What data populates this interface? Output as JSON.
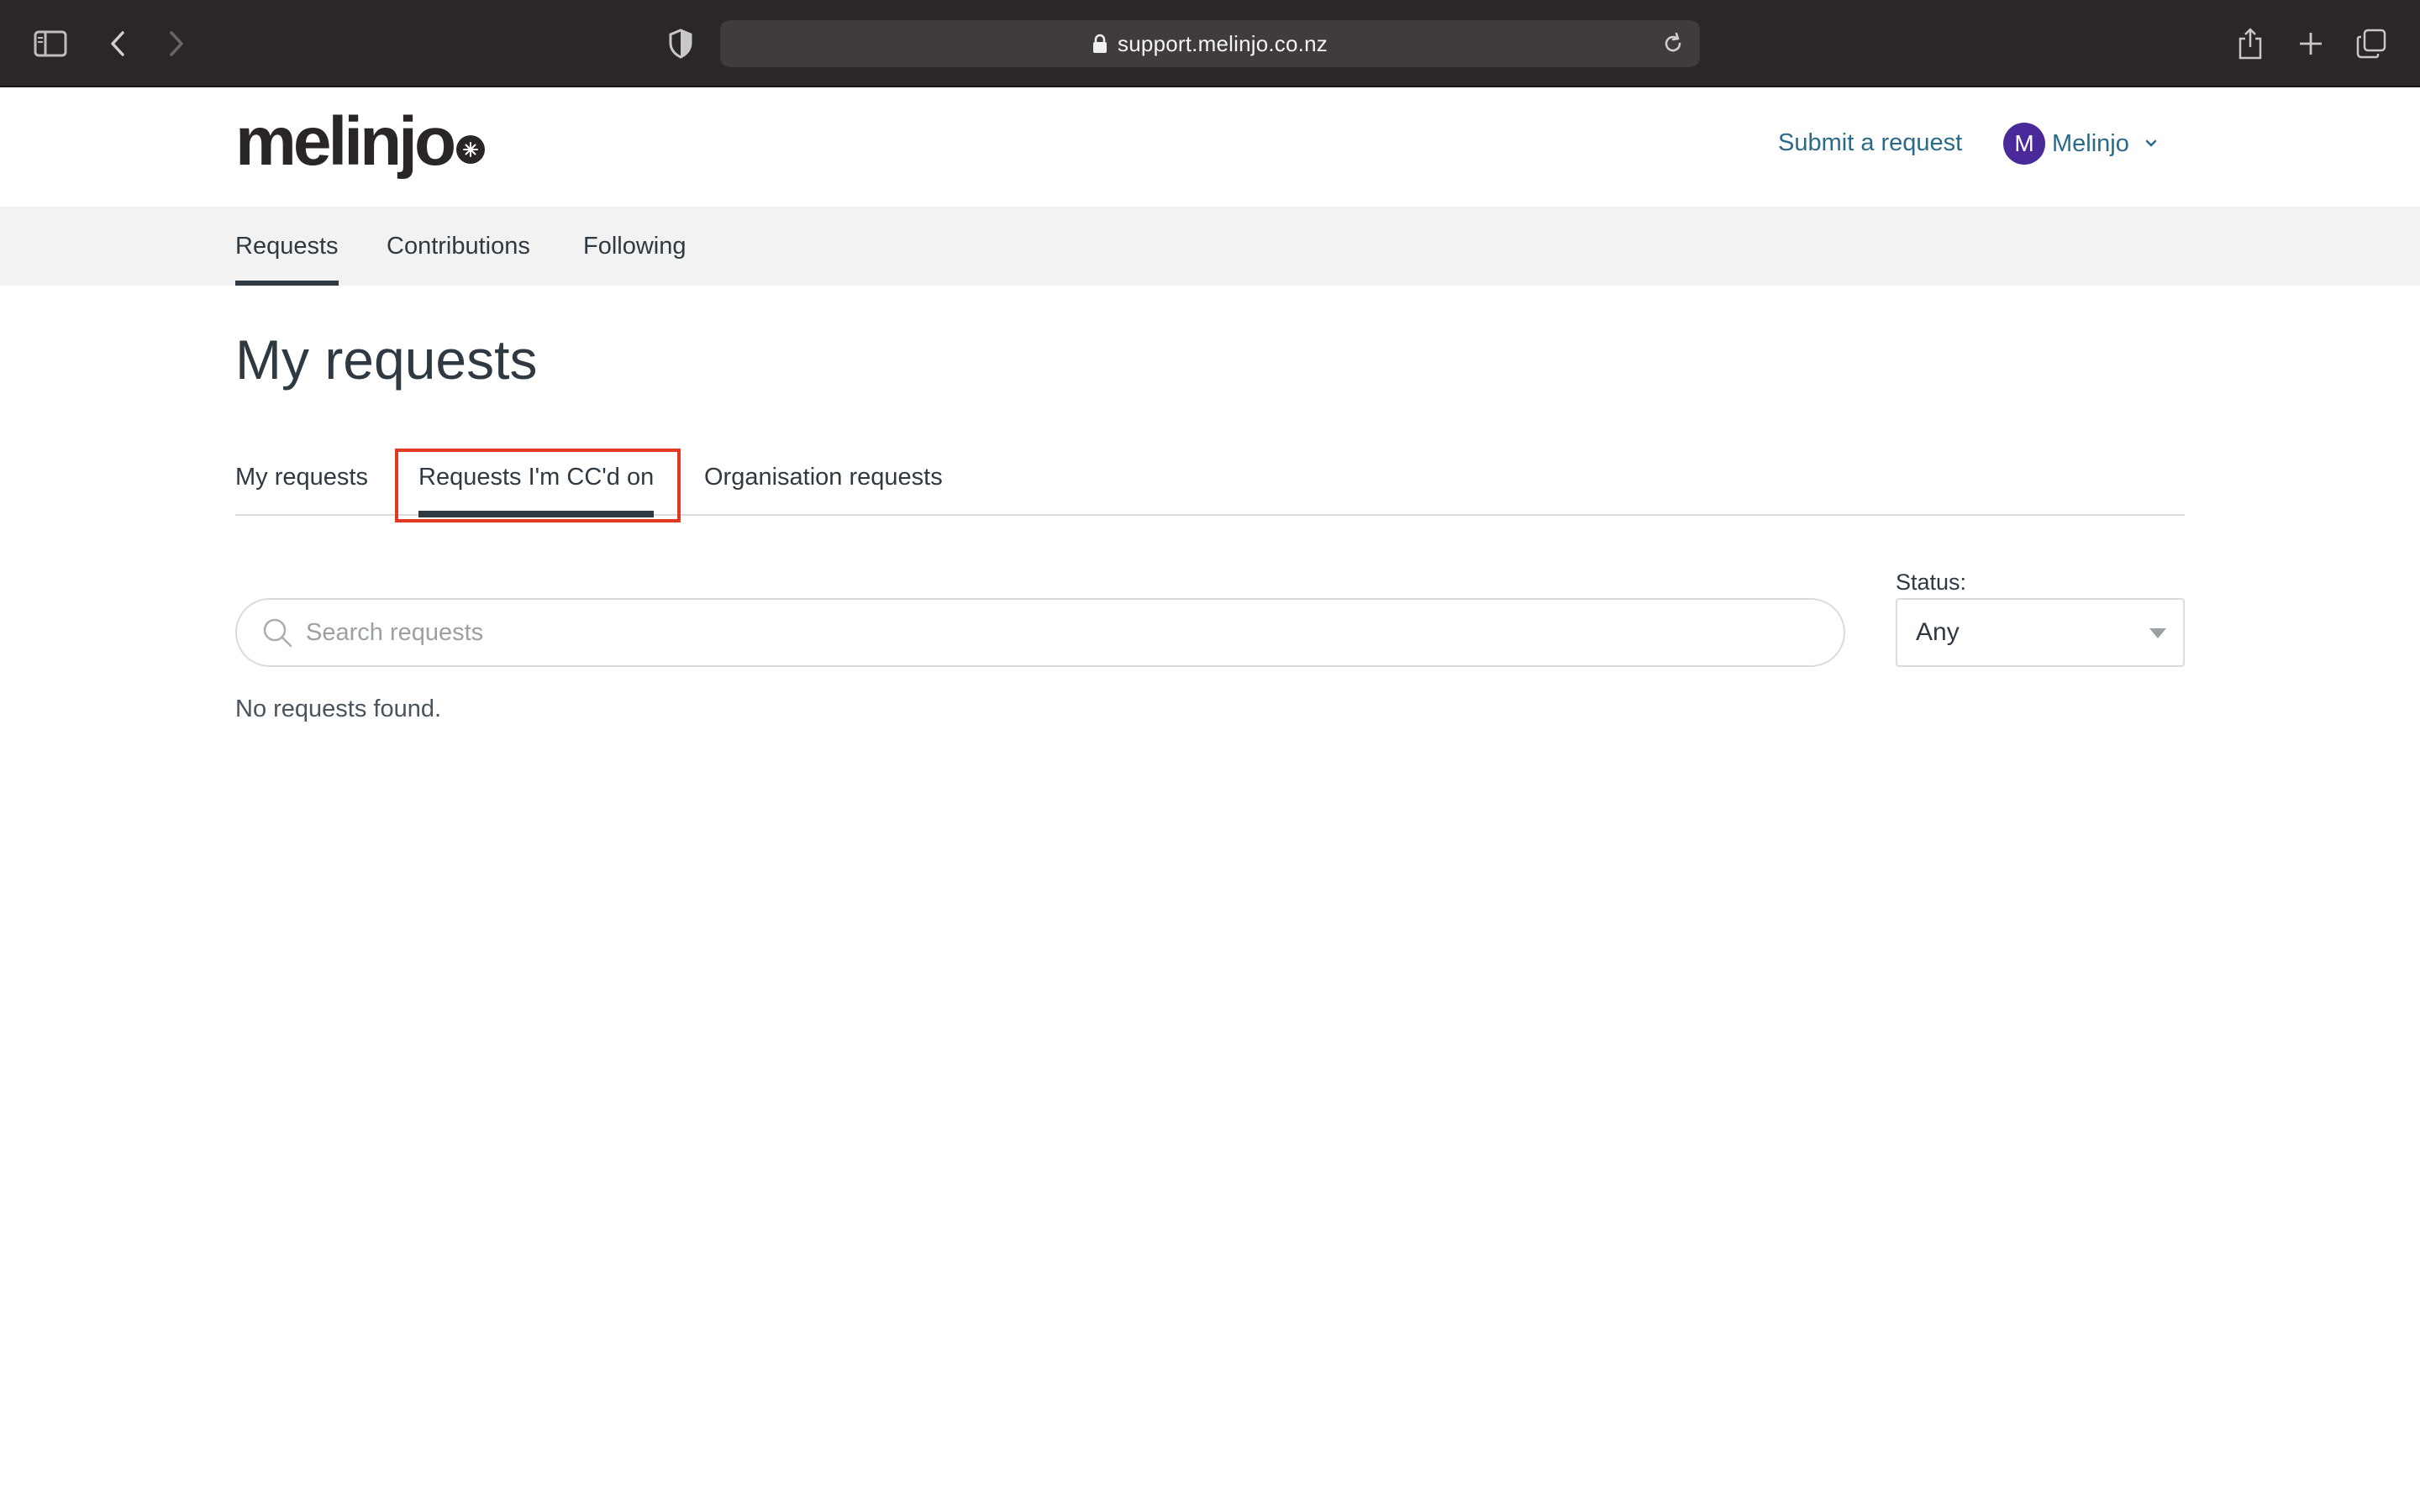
{
  "browser": {
    "url": "support.melinjo.co.nz"
  },
  "header": {
    "logo_text": "melinjo",
    "submit_request_label": "Submit a request",
    "user_initial": "M",
    "user_name": "Melinjo"
  },
  "subnav": {
    "items": [
      {
        "label": "Requests",
        "active": true
      },
      {
        "label": "Contributions",
        "active": false
      },
      {
        "label": "Following",
        "active": false
      }
    ]
  },
  "main": {
    "title": "My requests",
    "tabs": [
      {
        "label": "My requests",
        "active": false
      },
      {
        "label": "Requests I'm CC'd on",
        "active": true
      },
      {
        "label": "Organisation requests",
        "active": false
      }
    ],
    "search": {
      "placeholder": "Search requests",
      "value": ""
    },
    "status_filter": {
      "label": "Status:",
      "selected": "Any"
    },
    "empty_message": "No requests found."
  },
  "colors": {
    "highlight": "#e23a22",
    "link": "#2a6a8a",
    "avatar": "#4a2a9a",
    "chrome_bg": "#2b2628"
  }
}
